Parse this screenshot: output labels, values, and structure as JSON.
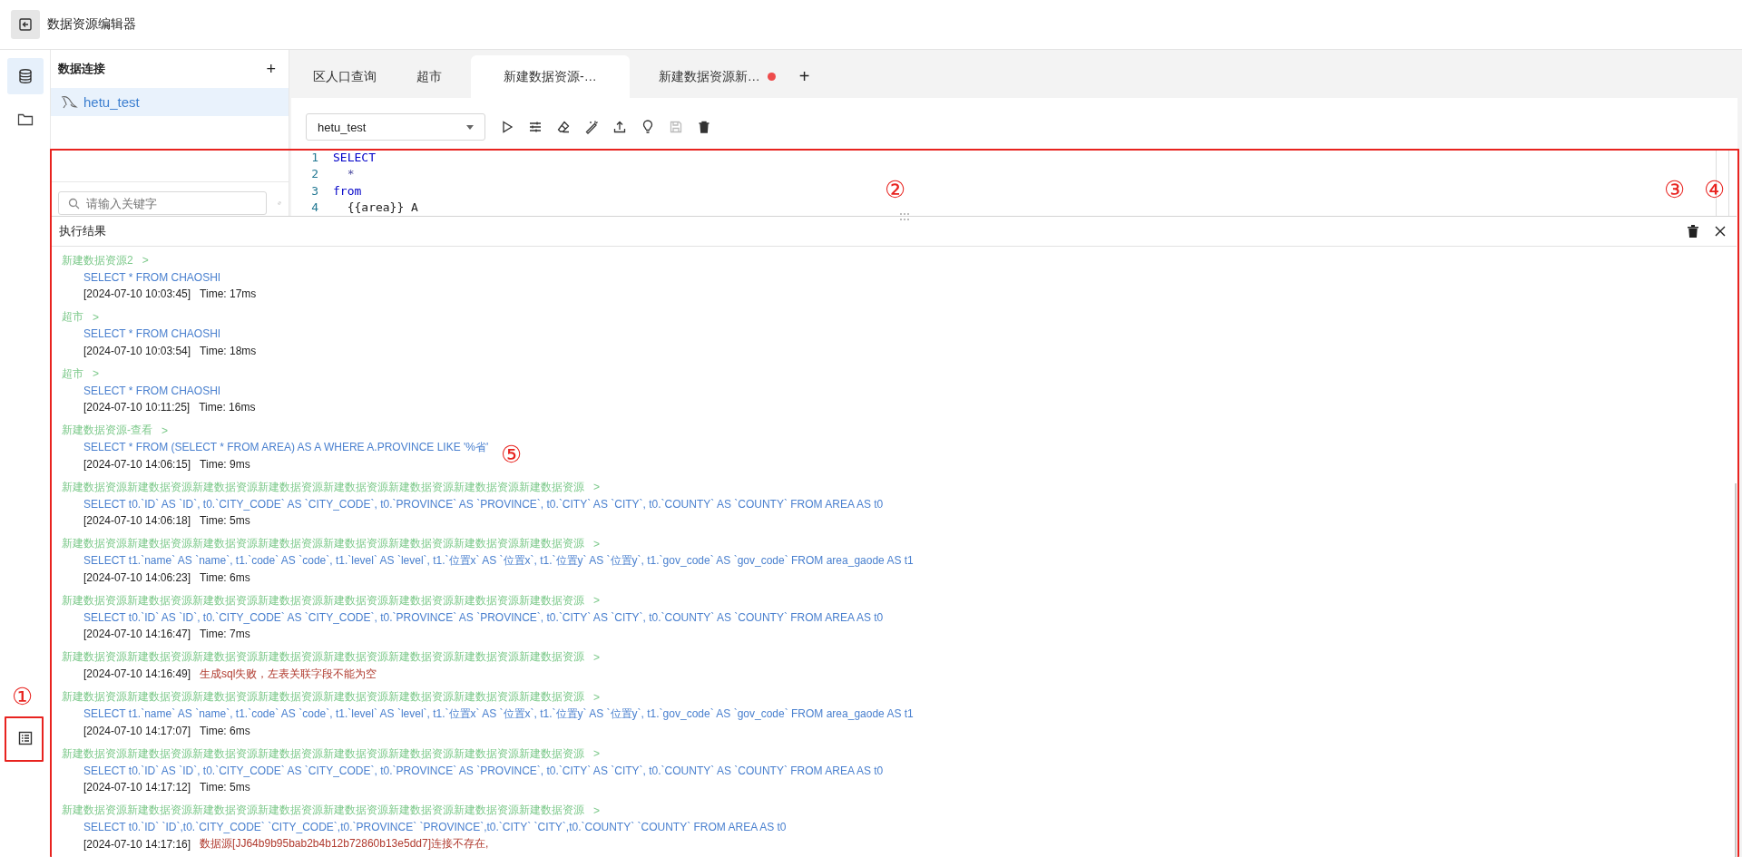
{
  "header": {
    "title": "数据资源编辑器"
  },
  "rail": [
    {
      "kind": "database",
      "selected": true
    },
    {
      "kind": "folder",
      "selected": false
    },
    {
      "kind": "list",
      "selected": false
    }
  ],
  "sidebar": {
    "title": "数据连接",
    "add": "+",
    "connections": [
      {
        "name": "hetu_test",
        "selected": true
      }
    ],
    "search": {
      "placeholder": "请输入关键字"
    }
  },
  "tabs": [
    {
      "label": "区人口查询",
      "selected": false,
      "unsaved": false
    },
    {
      "label": "超市",
      "selected": false,
      "unsaved": false
    },
    {
      "label": "新建数据资源-…",
      "selected": true,
      "unsaved": false
    },
    {
      "label": "新建数据资源新…",
      "selected": false,
      "unsaved": true
    }
  ],
  "add_tab": "+",
  "editor": {
    "datasource": "hetu_test",
    "toolbar": [
      {
        "kind": "run",
        "disabled": false
      },
      {
        "kind": "settings",
        "disabled": false
      },
      {
        "kind": "eraser",
        "disabled": false
      },
      {
        "kind": "wand",
        "disabled": false
      },
      {
        "kind": "upload",
        "disabled": false
      },
      {
        "kind": "bulb",
        "disabled": false
      },
      {
        "kind": "save",
        "disabled": true
      },
      {
        "kind": "delete",
        "disabled": false
      }
    ],
    "lines": [
      {
        "number": "1",
        "text": "SELECT",
        "kind": "keyword"
      },
      {
        "number": "2",
        "text": "  *",
        "kind": "operator"
      },
      {
        "number": "3",
        "text": "from",
        "kind": "keyword"
      },
      {
        "number": "4",
        "text": "  {{area}} A",
        "kind": "plain"
      }
    ]
  },
  "results": {
    "title": "执行结果",
    "entries": [
      {
        "source": "新建数据资源2",
        "toggle": ">",
        "sql": "SELECT * FROM CHAOSHI",
        "timestamp": "[2024-07-10 10:03:45]",
        "duration": "Time: 17ms"
      },
      {
        "source": "超市",
        "toggle": ">",
        "sql": "SELECT * FROM CHAOSHI",
        "timestamp": "[2024-07-10 10:03:54]",
        "duration": "Time: 18ms"
      },
      {
        "source": "超市",
        "toggle": ">",
        "sql": "SELECT * FROM CHAOSHI",
        "timestamp": "[2024-07-10 10:11:25]",
        "duration": "Time: 16ms"
      },
      {
        "source": "新建数据资源-查看",
        "toggle": ">",
        "sql": "SELECT * FROM (SELECT * FROM AREA) AS A WHERE A.PROVINCE LIKE '%省'",
        "timestamp": "[2024-07-10 14:06:15]",
        "duration": "Time: 9ms"
      },
      {
        "source": "新建数据资源新建数据资源新建数据资源新建数据资源新建数据资源新建数据资源新建数据资源新建数据资源",
        "toggle": ">",
        "sql": "SELECT t0.`ID` AS `ID`, t0.`CITY_CODE` AS `CITY_CODE`, t0.`PROVINCE` AS `PROVINCE`, t0.`CITY` AS `CITY`, t0.`COUNTY` AS `COUNTY` FROM AREA AS t0",
        "timestamp": "[2024-07-10 14:06:18]",
        "duration": "Time: 5ms"
      },
      {
        "source": "新建数据资源新建数据资源新建数据资源新建数据资源新建数据资源新建数据资源新建数据资源新建数据资源",
        "toggle": ">",
        "sql": "SELECT t1.`name` AS `name`, t1.`code` AS `code`, t1.`level` AS `level`, t1.`位置x` AS `位置x`, t1.`位置y` AS `位置y`, t1.`gov_code` AS `gov_code` FROM area_gaode AS t1",
        "timestamp": "[2024-07-10 14:06:23]",
        "duration": "Time: 6ms"
      },
      {
        "source": "新建数据资源新建数据资源新建数据资源新建数据资源新建数据资源新建数据资源新建数据资源新建数据资源",
        "toggle": ">",
        "sql": "SELECT t0.`ID` AS `ID`, t0.`CITY_CODE` AS `CITY_CODE`, t0.`PROVINCE` AS `PROVINCE`, t0.`CITY` AS `CITY`, t0.`COUNTY` AS `COUNTY` FROM AREA AS t0",
        "timestamp": "[2024-07-10 14:16:47]",
        "duration": "Time: 7ms"
      },
      {
        "source": "新建数据资源新建数据资源新建数据资源新建数据资源新建数据资源新建数据资源新建数据资源新建数据资源",
        "toggle": ">",
        "timestamp": "[2024-07-10 14:16:49]",
        "error": "生成sql失败，左表关联字段不能为空"
      },
      {
        "source": "新建数据资源新建数据资源新建数据资源新建数据资源新建数据资源新建数据资源新建数据资源新建数据资源",
        "toggle": ">",
        "sql": "SELECT t1.`name` AS `name`, t1.`code` AS `code`, t1.`level` AS `level`, t1.`位置x` AS `位置x`, t1.`位置y` AS `位置y`, t1.`gov_code` AS `gov_code` FROM area_gaode AS t1",
        "timestamp": "[2024-07-10 14:17:07]",
        "duration": "Time: 6ms"
      },
      {
        "source": "新建数据资源新建数据资源新建数据资源新建数据资源新建数据资源新建数据资源新建数据资源新建数据资源",
        "toggle": ">",
        "sql": "SELECT t0.`ID` AS `ID`, t0.`CITY_CODE` AS `CITY_CODE`, t0.`PROVINCE` AS `PROVINCE`, t0.`CITY` AS `CITY`, t0.`COUNTY` AS `COUNTY` FROM AREA AS t0",
        "timestamp": "[2024-07-10 14:17:12]",
        "duration": "Time: 5ms"
      },
      {
        "source": "新建数据资源新建数据资源新建数据资源新建数据资源新建数据资源新建数据资源新建数据资源新建数据资源",
        "toggle": ">",
        "sql": "SELECT t0.`ID` `ID`,t0.`CITY_CODE` `CITY_CODE`,t0.`PROVINCE` `PROVINCE`,t0.`CITY` `CITY`,t0.`COUNTY` `COUNTY` FROM AREA AS t0",
        "timestamp": "[2024-07-10 14:17:16]",
        "error": "数据源[JJ64b9b95bab2b4b12b72860b13e5dd7]连接不存在,"
      }
    ]
  },
  "annotations": [
    {
      "label": "①"
    },
    {
      "label": "②"
    },
    {
      "label": "③"
    },
    {
      "label": "④"
    },
    {
      "label": "⑤"
    }
  ]
}
